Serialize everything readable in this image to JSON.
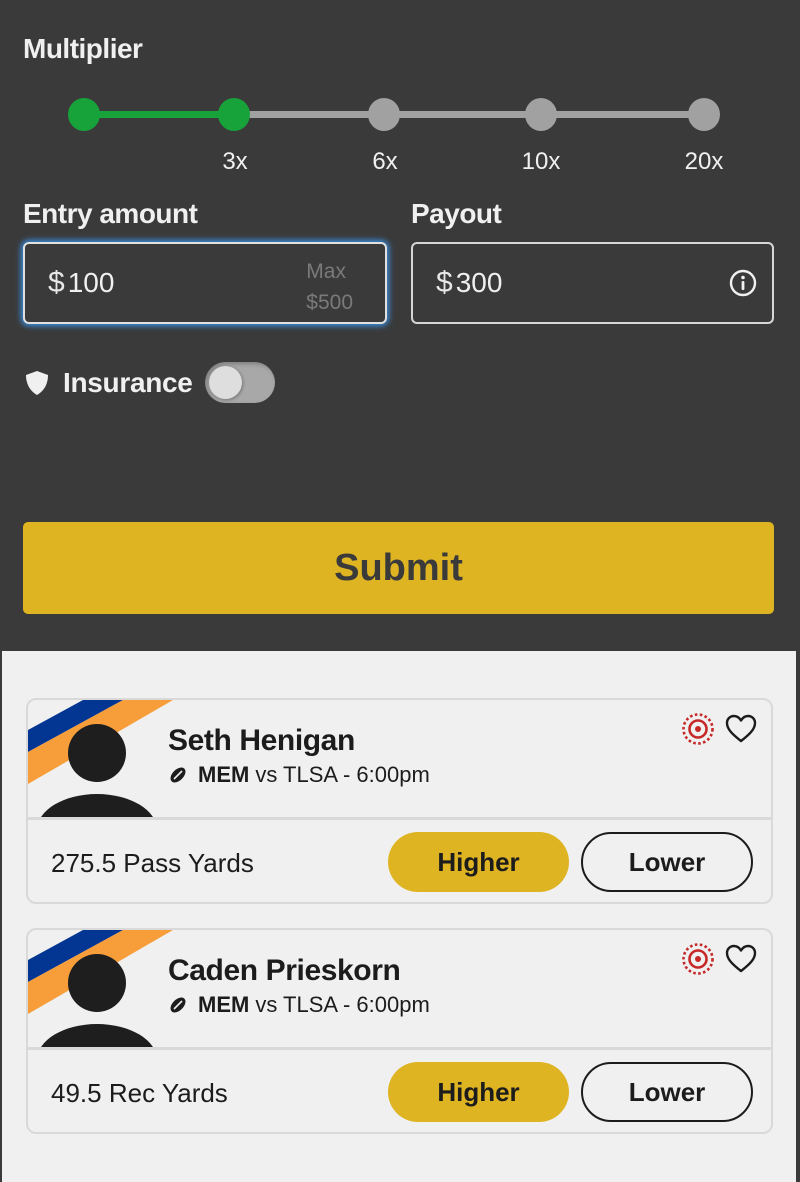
{
  "multiplier": {
    "title": "Multiplier",
    "stops": [
      {
        "label": "",
        "active": true
      },
      {
        "label": "3x",
        "active": true
      },
      {
        "label": "6x",
        "active": false
      },
      {
        "label": "10x",
        "active": false
      },
      {
        "label": "20x",
        "active": false
      }
    ],
    "selected": "3x"
  },
  "entry": {
    "label": "Entry amount",
    "currency": "$",
    "value": "100",
    "max_label": "Max",
    "max_value": "$500"
  },
  "payout": {
    "label": "Payout",
    "currency": "$",
    "value": "300",
    "info_icon": "info-icon"
  },
  "insurance": {
    "label": "Insurance",
    "icon": "shield-icon",
    "enabled": false
  },
  "submit_label": "Submit",
  "colors": {
    "accent_yellow": "#dfb423",
    "slider_active": "#17a33a",
    "slider_inactive": "#a1a1a1",
    "dark_bg": "#3a3a3a",
    "team_blue": "#033592",
    "team_orange": "#f79e3a",
    "target_red": "#c62828"
  },
  "picks": [
    {
      "player": "Seth Henigan",
      "team": "MEM",
      "vs": "vs TLSA - 6:00pm",
      "sport_icon": "football-icon",
      "stat": "275.5 Pass Yards",
      "higher_label": "Higher",
      "lower_label": "Lower"
    },
    {
      "player": "Caden Prieskorn",
      "team": "MEM",
      "vs": "vs TLSA - 6:00pm",
      "sport_icon": "football-icon",
      "stat": "49.5 Rec Yards",
      "higher_label": "Higher",
      "lower_label": "Lower"
    }
  ]
}
